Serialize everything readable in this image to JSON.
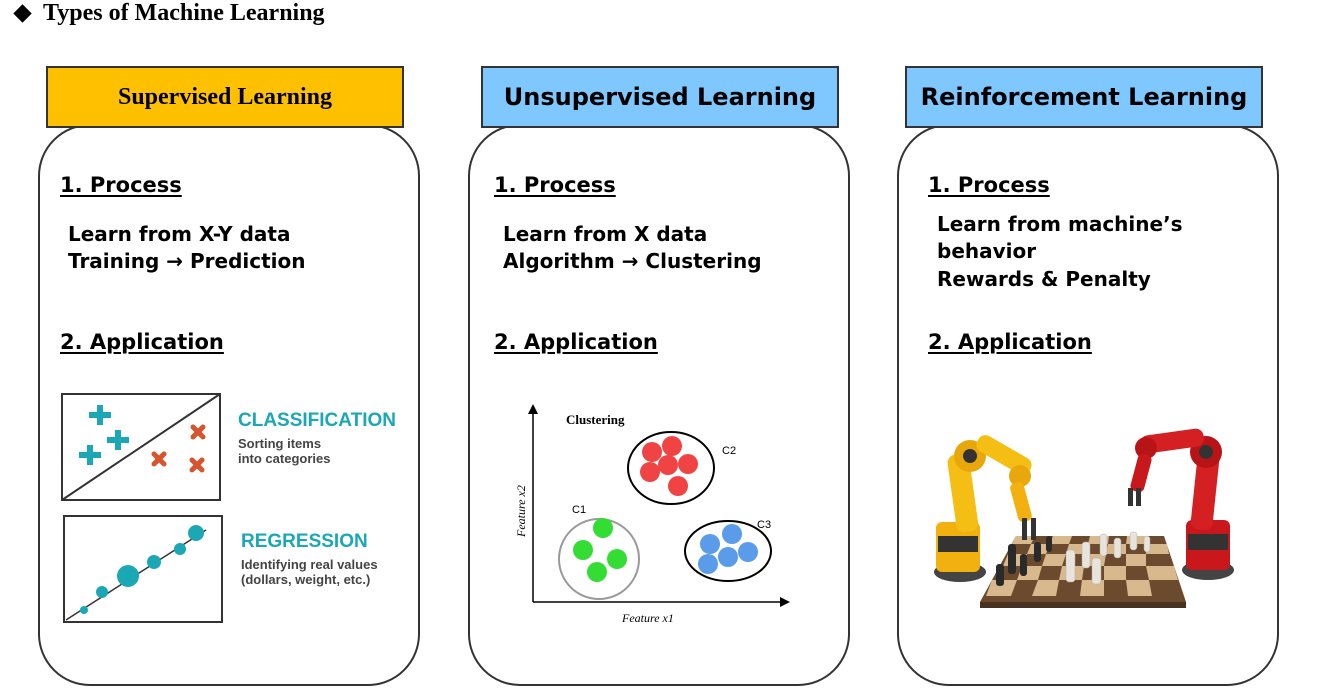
{
  "page": {
    "title": "Types of Machine Learning"
  },
  "colors": {
    "supervised_header": "#FFC000",
    "blue_header": "#7EC8FF",
    "teal": "#1BA8B4",
    "red_x": "#D9532C"
  },
  "supervised": {
    "header": "Supervised Learning",
    "process_title": "1. Process",
    "process_line1": "Learn from X-Y data",
    "process_line2": "Training → Prediction",
    "application_title": "2. Application",
    "image": {
      "classification_title": "CLASSIFICATION",
      "classification_desc1": "Sorting items",
      "classification_desc2": "into categories",
      "regression_title": "REGRESSION",
      "regression_desc1": "Identifying real values",
      "regression_desc2": "(dollars, weight, etc.)"
    }
  },
  "unsupervised": {
    "header": "Unsupervised Learning",
    "process_title": "1. Process",
    "process_line1": "Learn from X data",
    "process_line2": "Algorithm → Clustering",
    "application_title": "2. Application",
    "image": {
      "title": "Clustering",
      "xlabel": "Feature x1",
      "ylabel": "Feature x2",
      "c1": "C1",
      "c2": "C2",
      "c3": "C3"
    }
  },
  "reinforcement": {
    "header": "Reinforcement Learning",
    "process_title": "1. Process",
    "process_line1": "Learn from machine’s",
    "process_line2": "behavior",
    "process_line3": "Rewards & Penalty",
    "application_title": "2. Application"
  }
}
